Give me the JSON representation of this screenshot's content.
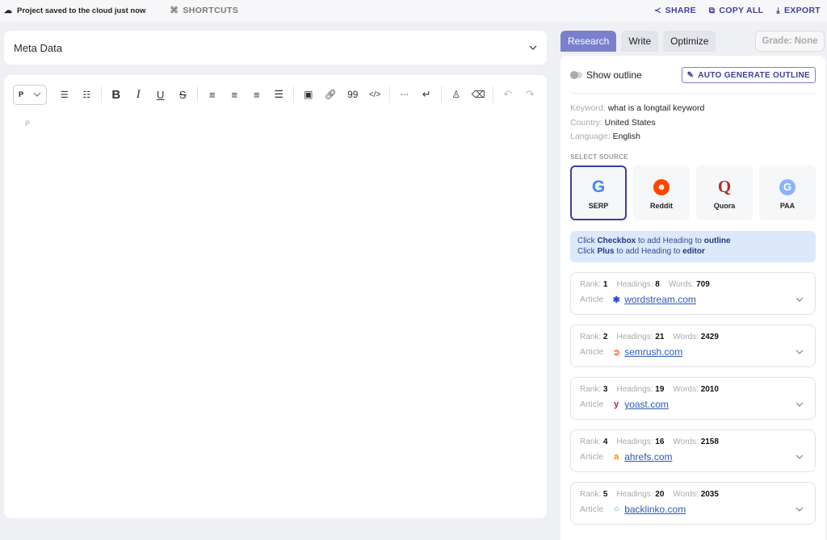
{
  "topbar": {
    "save_status": "Project saved to the cloud just now",
    "shortcuts_label": "SHORTCUTS",
    "actions": [
      {
        "label": "SHARE",
        "icon": "share-icon"
      },
      {
        "label": "COPY ALL",
        "icon": "copy-icon"
      },
      {
        "label": "EXPORT",
        "icon": "download-icon"
      }
    ]
  },
  "meta": {
    "title": "Meta Data"
  },
  "editor": {
    "block_type": "P",
    "placeholder": "P",
    "toolbar": [
      "bullet-list",
      "numbered-list",
      "bold",
      "italic",
      "underline",
      "strikethrough",
      "align-left",
      "align-center",
      "align-right",
      "justify",
      "image",
      "link",
      "quote",
      "code",
      "horizontal-rule",
      "line-break",
      "format-paint",
      "clear-format",
      "undo",
      "redo"
    ]
  },
  "tabs": [
    {
      "label": "Research",
      "active": true
    },
    {
      "label": "Write",
      "active": false
    },
    {
      "label": "Optimize",
      "active": false
    }
  ],
  "grade": "Grade: None",
  "research": {
    "show_outline_label": "Show outline",
    "auto_generate_label": "AUTO GENERATE OUTLINE",
    "keyword_label": "Keyword:",
    "keyword": "what is a longtail keyword",
    "country_label": "Country:",
    "country": "United States",
    "language_label": "Language:",
    "language": "English",
    "select_source_label": "SELECT SOURCE",
    "sources": [
      {
        "label": "SERP",
        "active": true
      },
      {
        "label": "Reddit",
        "active": false
      },
      {
        "label": "Quora",
        "active": false
      },
      {
        "label": "PAA",
        "active": false
      }
    ],
    "hint": {
      "line1_a": "Click ",
      "line1_b": "Checkbox",
      "line1_c": " to add Heading to ",
      "line1_d": "outline",
      "line2_a": "Click ",
      "line2_b": "Plus",
      "line2_c": " to add Heading to ",
      "line2_d": "editor"
    },
    "rank_label": "Rank:",
    "headings_label": "Headings:",
    "words_label": "Words:",
    "type_label": "Article",
    "results": [
      {
        "rank": "1",
        "headings": "8",
        "words": "709",
        "domain": "wordstream.com",
        "fav": "✱",
        "fav_color": "#2b48d8"
      },
      {
        "rank": "2",
        "headings": "21",
        "words": "2429",
        "domain": "semrush.com",
        "fav": "➲",
        "fav_color": "#ff642d"
      },
      {
        "rank": "3",
        "headings": "19",
        "words": "2010",
        "domain": "yoast.com",
        "fav": "y",
        "fav_color": "#a4286a"
      },
      {
        "rank": "4",
        "headings": "16",
        "words": "2158",
        "domain": "ahrefs.com",
        "fav": "a",
        "fav_color": "#ff8800"
      },
      {
        "rank": "5",
        "headings": "20",
        "words": "2035",
        "domain": "backlinko.com",
        "fav": "○",
        "fav_color": "#3aac4e"
      }
    ]
  }
}
